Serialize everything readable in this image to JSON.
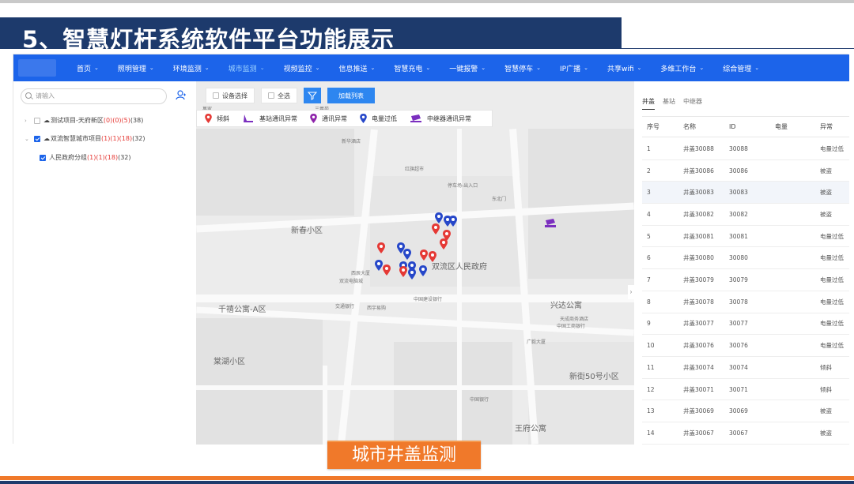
{
  "slide": {
    "title": "5、智慧灯杆系统软件平台功能展示",
    "caption": "城市井盖监测"
  },
  "nav": {
    "items": [
      {
        "label": "首页"
      },
      {
        "label": "照明管理"
      },
      {
        "label": "环境监测"
      },
      {
        "label": "城市监测"
      },
      {
        "label": "视频监控"
      },
      {
        "label": "信息推送"
      },
      {
        "label": "智慧充电"
      },
      {
        "label": "一键报警"
      },
      {
        "label": "智慧停车"
      },
      {
        "label": "IP广播"
      },
      {
        "label": "共享wifi"
      },
      {
        "label": "多维工作台"
      },
      {
        "label": "综合管理"
      }
    ],
    "active": "城市监测"
  },
  "left": {
    "search_placeholder": "请输入",
    "tree": [
      {
        "label": "测试项目-天府新区",
        "counts": "(0)(0)(5)",
        "total": "(38)"
      },
      {
        "label": "双流智慧城市项目",
        "counts": "(1)(1)(18)",
        "total": "(32)"
      },
      {
        "label": "人民政府分组",
        "counts": "(1)(1)(18)",
        "total": "(32)"
      }
    ]
  },
  "map": {
    "toolbar": {
      "device_select": "设备选择",
      "select_all": "全选",
      "load_list": "加载列表"
    },
    "legend": [
      "倾斜",
      "基站通讯异常",
      "通讯异常",
      "电量过低",
      "中继器通讯异常"
    ],
    "labels": {
      "new_spring": "新春小区",
      "govt": "双流区人民政府",
      "qianxi": "千禧公寓-A区",
      "xingda": "兴达公寓",
      "tanghu": "棠湖小区",
      "xinjie": "新街50号小区",
      "wangfu": "王府公寓",
      "sanyi": "三義苑",
      "wanjia": "萬家",
      "hongxing": "红旗超市",
      "tingche": "停车场-出入口",
      "bank_china": "中国银行",
      "jianshe": "中国建设银行",
      "gongshang": "中国工商银行",
      "xichen": "西辰大厦",
      "jiaotong": "交通银行",
      "xiyu": "西宇易购",
      "guangyi": "广毅大厦",
      "tianyuan": "天成商务酒店",
      "shuangliu_hall": "双流电脑城",
      "xinhua": "新华酒店",
      "dongbei": "东北门"
    },
    "colors": {
      "red_pin": "#e53935",
      "blue_pin": "#2647c9",
      "purple": "#7b2fbf"
    }
  },
  "right": {
    "tabs": [
      "井盖",
      "基站",
      "中继器"
    ],
    "active_tab": "井盖",
    "columns": [
      "序号",
      "名称",
      "ID",
      "电量",
      "异常"
    ],
    "rows": [
      {
        "no": "1",
        "name": "井盖30088",
        "id": "30088",
        "power": "",
        "status": "电量过低"
      },
      {
        "no": "2",
        "name": "井盖30086",
        "id": "30086",
        "power": "",
        "status": "被盗"
      },
      {
        "no": "3",
        "name": "井盖30083",
        "id": "30083",
        "power": "",
        "status": "被盗"
      },
      {
        "no": "4",
        "name": "井盖30082",
        "id": "30082",
        "power": "",
        "status": "被盗"
      },
      {
        "no": "5",
        "name": "井盖30081",
        "id": "30081",
        "power": "",
        "status": "电量过低"
      },
      {
        "no": "6",
        "name": "井盖30080",
        "id": "30080",
        "power": "",
        "status": "电量过低"
      },
      {
        "no": "7",
        "name": "井盖30079",
        "id": "30079",
        "power": "",
        "status": "电量过低"
      },
      {
        "no": "8",
        "name": "井盖30078",
        "id": "30078",
        "power": "",
        "status": "电量过低"
      },
      {
        "no": "9",
        "name": "井盖30077",
        "id": "30077",
        "power": "",
        "status": "电量过低"
      },
      {
        "no": "10",
        "name": "井盖30076",
        "id": "30076",
        "power": "",
        "status": "电量过低"
      },
      {
        "no": "11",
        "name": "井盖30074",
        "id": "30074",
        "power": "",
        "status": "倾斜"
      },
      {
        "no": "12",
        "name": "井盖30071",
        "id": "30071",
        "power": "",
        "status": "倾斜"
      },
      {
        "no": "13",
        "name": "井盖30069",
        "id": "30069",
        "power": "",
        "status": "被盗"
      },
      {
        "no": "14",
        "name": "井盖30067",
        "id": "30067",
        "power": "",
        "status": "被盗"
      }
    ]
  }
}
